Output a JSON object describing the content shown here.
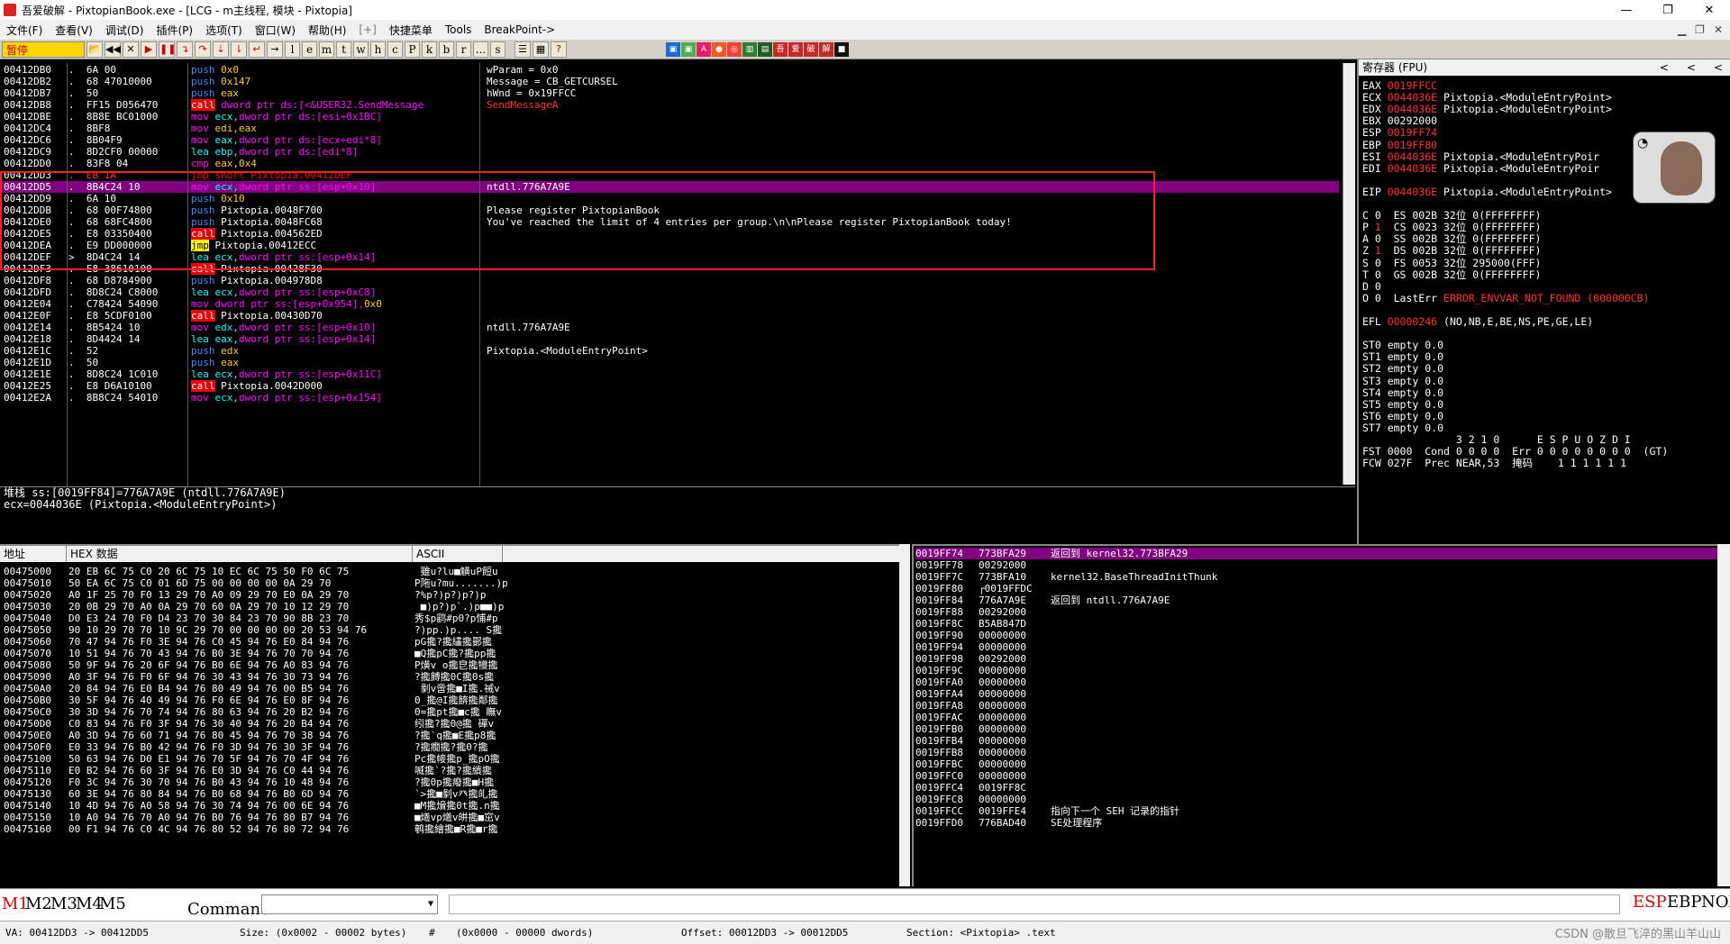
{
  "window": {
    "title": "吾爱破解 - PixtopianBook.exe - [LCG - m主线程, 模块 - Pixtopia]",
    "controls": [
      "—",
      "❐",
      "✕"
    ]
  },
  "menu": {
    "items": [
      "文件(F)",
      "查看(V)",
      "调试(D)",
      "插件(P)",
      "选项(T)",
      "窗口(W)",
      "帮助(H)",
      "[+]",
      "快捷菜单",
      "Tools",
      "BreakPoint->"
    ]
  },
  "toolbar": {
    "status": "暂停",
    "letters": [
      "l",
      "e",
      "m",
      "t",
      "w",
      "h",
      "c",
      "P",
      "k",
      "b",
      "r",
      "...",
      "s"
    ],
    "chinese": [
      "吾",
      "爱",
      "破",
      "解"
    ]
  },
  "cpu": {
    "rows": [
      {
        "addr": "00412DB0",
        "mark": ".",
        "hex": "6A 00",
        "asm": [
          [
            "push",
            "kw-push"
          ],
          [
            " 0x0",
            "num"
          ]
        ],
        "cmt": "wParam = 0x0"
      },
      {
        "addr": "00412DB2",
        "mark": ".",
        "hex": "68 47010000",
        "asm": [
          [
            "push",
            "kw-push"
          ],
          [
            " 0x147",
            "num"
          ]
        ],
        "cmt": "Message = CB_GETCURSEL"
      },
      {
        "addr": "00412DB7",
        "mark": ".",
        "hex": "50",
        "asm": [
          [
            "push",
            "kw-push"
          ],
          [
            " eax",
            "num"
          ]
        ],
        "cmt": "hWnd = 0x19FFCC"
      },
      {
        "addr": "00412DB8",
        "mark": ".",
        "hex": "FF15 D056470",
        "asm": [
          [
            "call",
            "kw-call"
          ],
          [
            " dword ptr ds:[<&USER32.SendMessage",
            "kw-mov"
          ]
        ],
        "cmt": "SendMessageA",
        "cmtClass": "red"
      },
      {
        "addr": "00412DBE",
        "mark": ".",
        "hex": "8B8E BC01000",
        "asm": [
          [
            "mov",
            "kw-mov"
          ],
          [
            " ecx,",
            "kw-lea"
          ],
          [
            "dword ptr ds:[esi+0x1BC]",
            "kw-mov"
          ]
        ],
        "cmt": ""
      },
      {
        "addr": "00412DC4",
        "mark": ".",
        "hex": "8BF8",
        "asm": [
          [
            "mov",
            "kw-mov"
          ],
          [
            " edi,eax",
            "num"
          ]
        ],
        "cmt": ""
      },
      {
        "addr": "00412DC6",
        "mark": ".",
        "hex": "8B04F9",
        "asm": [
          [
            "mov",
            "kw-mov"
          ],
          [
            " eax,",
            "kw-lea"
          ],
          [
            "dword ptr ds:[ecx+edi*8]",
            "kw-mov"
          ]
        ],
        "cmt": ""
      },
      {
        "addr": "00412DC9",
        "mark": ".",
        "hex": "8D2CF0 00000",
        "asm": [
          [
            "lea",
            "kw-lea"
          ],
          [
            " ebp,",
            "kw-lea"
          ],
          [
            "dword ptr ds:[edi*8]",
            "kw-mov"
          ]
        ],
        "cmt": ""
      },
      {
        "addr": "00412DD0",
        "mark": ".",
        "hex": "83F8 04",
        "asm": [
          [
            "cmp",
            "kw-cmp"
          ],
          [
            " eax,0x4",
            "num"
          ]
        ],
        "cmt": ""
      },
      {
        "addr": "00412DD3",
        "mark": ".",
        "hex": "EB 1A",
        "hexClass": "red",
        "asm": [
          [
            "jmp short Pixtopia.00412DEF",
            "kw-jmpr"
          ]
        ],
        "cmt": ""
      },
      {
        "addr": "00412DD5",
        "mark": ".",
        "hex": "8B4C24 10",
        "asm": [
          [
            "mov",
            "kw-mov"
          ],
          [
            " ecx,",
            "kw-lea"
          ],
          [
            "dword ptr ss:[esp+0x10]",
            "kw-mov"
          ]
        ],
        "cmt": "ntdll.776A7A9E",
        "sel": true
      },
      {
        "addr": "00412DD9",
        "mark": ".",
        "hex": "6A 10",
        "asm": [
          [
            "push",
            "kw-push"
          ],
          [
            " 0x10",
            "num"
          ]
        ],
        "cmt": ""
      },
      {
        "addr": "00412DDB",
        "mark": ".",
        "hex": "68 00F74800",
        "asm": [
          [
            "push",
            "kw-push"
          ],
          [
            " Pixtopia.0048F700",
            "ops"
          ]
        ],
        "cmt": "Please register PixtopianBook"
      },
      {
        "addr": "00412DE0",
        "mark": ".",
        "hex": "68 68FC4800",
        "asm": [
          [
            "push",
            "kw-push"
          ],
          [
            " Pixtopia.0048FC68",
            "ops"
          ]
        ],
        "cmt": "You've reached the limit of 4 entries per group.\\n\\nPlease register PixtopianBook today!"
      },
      {
        "addr": "00412DE5",
        "mark": ".",
        "hex": "E8 03350400",
        "asm": [
          [
            "call",
            "kw-call"
          ],
          [
            " Pixtopia.004562ED",
            "ops"
          ]
        ],
        "cmt": ""
      },
      {
        "addr": "00412DEA",
        "mark": ".",
        "hex": "E9 DD000000",
        "asm": [
          [
            "jmp",
            "kw-jmp"
          ],
          [
            " Pixtopia.00412ECC",
            "ops"
          ]
        ],
        "cmt": ""
      },
      {
        "addr": "00412DEF",
        "mark": ">",
        "hex": "8D4C24 14",
        "asm": [
          [
            "lea",
            "kw-lea"
          ],
          [
            " ecx,",
            "kw-lea"
          ],
          [
            "dword ptr ss:[esp+0x14]",
            "kw-mov"
          ]
        ],
        "cmt": ""
      },
      {
        "addr": "00412DF3",
        "mark": ".",
        "hex": "E8 38610100",
        "asm": [
          [
            "call",
            "kw-call"
          ],
          [
            " Pixtopia.00428F30",
            "ops"
          ]
        ],
        "cmt": ""
      },
      {
        "addr": "00412DF8",
        "mark": ".",
        "hex": "68 D8784900",
        "asm": [
          [
            "push",
            "kw-push"
          ],
          [
            " Pixtopia.004978D8",
            "ops"
          ]
        ],
        "cmt": ""
      },
      {
        "addr": "00412DFD",
        "mark": ".",
        "hex": "8D8C24 C8000",
        "asm": [
          [
            "lea",
            "kw-lea"
          ],
          [
            " ecx,",
            "kw-lea"
          ],
          [
            "dword ptr ss:[esp+0xC8]",
            "kw-mov"
          ]
        ],
        "cmt": ""
      },
      {
        "addr": "00412E04",
        "mark": ".",
        "hex": "C78424 54090",
        "asm": [
          [
            "mov",
            "kw-mov"
          ],
          [
            " dword ptr ss:[esp+0x954],",
            "kw-mov"
          ],
          [
            "0x0",
            "num"
          ]
        ],
        "cmt": ""
      },
      {
        "addr": "00412E0F",
        "mark": ".",
        "hex": "E8 5CDF0100",
        "asm": [
          [
            "call",
            "kw-call"
          ],
          [
            " Pixtopia.00430D70",
            "ops"
          ]
        ],
        "cmt": ""
      },
      {
        "addr": "00412E14",
        "mark": ".",
        "hex": "8B5424 10",
        "asm": [
          [
            "mov",
            "kw-mov"
          ],
          [
            " edx,",
            "kw-lea"
          ],
          [
            "dword ptr ss:[esp+0x10]",
            "kw-mov"
          ]
        ],
        "cmt": "ntdll.776A7A9E"
      },
      {
        "addr": "00412E18",
        "mark": ".",
        "hex": "8D4424 14",
        "asm": [
          [
            "lea",
            "kw-lea"
          ],
          [
            " eax,",
            "kw-lea"
          ],
          [
            "dword ptr ss:[esp+0x14]",
            "kw-mov"
          ]
        ],
        "cmt": ""
      },
      {
        "addr": "00412E1C",
        "mark": ".",
        "hex": "52",
        "asm": [
          [
            "push",
            "kw-push"
          ],
          [
            " edx",
            "num"
          ]
        ],
        "cmt": "Pixtopia.<ModuleEntryPoint>"
      },
      {
        "addr": "00412E1D",
        "mark": ".",
        "hex": "50",
        "asm": [
          [
            "push",
            "kw-push"
          ],
          [
            " eax",
            "num"
          ]
        ],
        "cmt": ""
      },
      {
        "addr": "00412E1E",
        "mark": ".",
        "hex": "8D8C24 1C010",
        "asm": [
          [
            "lea",
            "kw-lea"
          ],
          [
            " ecx,",
            "kw-lea"
          ],
          [
            "dword ptr ss:[esp+0x11C]",
            "kw-mov"
          ]
        ],
        "cmt": ""
      },
      {
        "addr": "00412E25",
        "mark": ".",
        "hex": "E8 D6A10100",
        "asm": [
          [
            "call",
            "kw-call"
          ],
          [
            " Pixtopia.0042D000",
            "ops"
          ]
        ],
        "cmt": ""
      },
      {
        "addr": "00412E2A",
        "mark": ".",
        "hex": "8B8C24 54010",
        "asm": [
          [
            "mov",
            "kw-mov"
          ],
          [
            " ecx,",
            "kw-lea"
          ],
          [
            "dword ptr ss:[esp+0x154]",
            "kw-mov"
          ]
        ],
        "cmt": ""
      }
    ]
  },
  "info": {
    "line1": "堆栈 ss:[0019FF84]=776A7A9E (ntdll.776A7A9E)",
    "line2": "ecx=0044036E (Pixtopia.<ModuleEntryPoint>)"
  },
  "registers": {
    "header": "寄存器 (FPU)",
    "lines": [
      [
        [
          "EAX ",
          "w"
        ],
        [
          "0019FFCC",
          "r"
        ]
      ],
      [
        [
          "ECX ",
          "w"
        ],
        [
          "0044036E",
          "r"
        ],
        [
          " Pixtopia.<ModuleEntryPoint>",
          "w"
        ]
      ],
      [
        [
          "EDX ",
          "w"
        ],
        [
          "0044036E",
          "r"
        ],
        [
          " Pixtopia.<ModuleEntryPoint>",
          "w"
        ]
      ],
      [
        [
          "EBX 00292000",
          "w"
        ]
      ],
      [
        [
          "ESP ",
          "w"
        ],
        [
          "0019FF74",
          "r"
        ]
      ],
      [
        [
          "EBP ",
          "w"
        ],
        [
          "0019FF80",
          "r"
        ]
      ],
      [
        [
          "ESI ",
          "w"
        ],
        [
          "0044036E",
          "r"
        ],
        [
          " Pixtopia.<ModuleEntryPoir",
          "w"
        ]
      ],
      [
        [
          "EDI ",
          "w"
        ],
        [
          "0044036E",
          "r"
        ],
        [
          " Pixtopia.<ModuleEntryPoir",
          "w"
        ]
      ],
      [
        [
          "",
          ""
        ]
      ],
      [
        [
          "EIP ",
          "w"
        ],
        [
          "0044036E",
          "r"
        ],
        [
          " Pixtopia.<ModuleEntryPoint>",
          "w"
        ]
      ],
      [
        [
          "",
          ""
        ]
      ],
      [
        [
          "C 0  ES 002B 32位 0(FFFFFFFF)",
          "w"
        ]
      ],
      [
        [
          "P ",
          "w"
        ],
        [
          "1",
          "r"
        ],
        [
          "  CS 0023 32位 0(FFFFFFFF)",
          "w"
        ]
      ],
      [
        [
          "A 0  SS 002B 32位 0(FFFFFFFF)",
          "w"
        ]
      ],
      [
        [
          "Z ",
          "w"
        ],
        [
          "1",
          "r"
        ],
        [
          "  DS 002B 32位 0(FFFFFFFF)",
          "w"
        ]
      ],
      [
        [
          "S 0  FS 0053 32位 295000(FFF)",
          "w"
        ]
      ],
      [
        [
          "T 0  GS 002B 32位 0(FFFFFFFF)",
          "w"
        ]
      ],
      [
        [
          "D 0",
          "w"
        ]
      ],
      [
        [
          "O 0  LastErr ",
          "w"
        ],
        [
          "ERROR_ENVVAR_NOT_FOUND (000000CB)",
          "r"
        ]
      ],
      [
        [
          "",
          ""
        ]
      ],
      [
        [
          "EFL ",
          "w"
        ],
        [
          "00000246",
          "r"
        ],
        [
          " (NO,NB,E,BE,NS,PE,GE,LE)",
          "w"
        ]
      ],
      [
        [
          "",
          ""
        ]
      ],
      [
        [
          "ST0 empty 0.0",
          "w"
        ]
      ],
      [
        [
          "ST1 empty 0.0",
          "w"
        ]
      ],
      [
        [
          "ST2 empty 0.0",
          "w"
        ]
      ],
      [
        [
          "ST3 empty 0.0",
          "w"
        ]
      ],
      [
        [
          "ST4 empty 0.0",
          "w"
        ]
      ],
      [
        [
          "ST5 empty 0.0",
          "w"
        ]
      ],
      [
        [
          "ST6 empty 0.0",
          "w"
        ]
      ],
      [
        [
          "ST7 empty 0.0",
          "w"
        ]
      ],
      [
        [
          "               3 2 1 0      E S P U O Z D I",
          "w"
        ]
      ],
      [
        [
          "FST 0000  Cond 0 0 0 0  Err 0 0 0 0 0 0 0 0  (GT)",
          "w"
        ]
      ],
      [
        [
          "FCW 027F  Prec NEAR,53  掩码    1 1 1 1 1 1",
          "w"
        ]
      ]
    ]
  },
  "dump": {
    "headers": [
      "地址",
      "HEX 数据",
      "ASCII"
    ],
    "rows": [
      [
        "00475000",
        "20 EB 6C 75 C0 20 6C 75 10 EC 6C 75 50 F0 6C 75",
        " 雖u?lu■觵uP餖u"
      ],
      [
        "00475010",
        "50 EA 6C 75 C0 01 6D 75 00 00 00 00 0A 29 70",
        "P陁u?mu.......)p"
      ],
      [
        "00475020",
        "A0 1F 25 70 F0 13 29 70 A0 09 29 70 E0 0A 29 70",
        "?%p?)p?)p?)p"
      ],
      [
        "00475030",
        "20 0B 29 70 A0 0A 29 70 60 0A 29 70 10 12 29 70",
        " ■)p?)p`.)p■■)p"
      ],
      [
        "00475040",
        "D0 E3 24 70 F0 D4 23 70 30 84 23 70 90 8B 23 70",
        "秀$p鹞#p0?p悑#p"
      ],
      [
        "00475050",
        "90 10 29 70 70 10 9C 29 70 00 00 00 00 20 53 94 76",
        "?)pp.)p.... S攙"
      ],
      [
        "00475060",
        "70 47 94 76 F0 3E 94 76 C0 45 94 76 E0 84 94 76",
        "pG攙?攙繣攙鄤攙"
      ],
      [
        "00475070",
        "10 51 94 76 70 43 94 76 B0 3E 94 76 70 70 94 76",
        "■Q攙pC攙?攙pp攙"
      ],
      [
        "00475080",
        "50 9F 94 76 20 6F 94 76 B0 6E 94 76 A0 83 94 76",
        "P熿v o攙皀攙犪攙"
      ],
      [
        "00475090",
        "A0 3F 94 76 F0 6F 94 76 30 43 94 76 30 73 94 76",
        "?攙餺攙0C攙0s攙"
      ],
      [
        "004750A0",
        "20 84 94 76 E0 B4 94 76 80 49 94 76 00 B5 94 76",
        " 剶v啻攙■I攙.祴v"
      ],
      [
        "004750B0",
        "30 5F 94 76 40 49 94 76 F0 6E 94 76 E0 8F 94 76",
        "0_攙@I攙餴攙鄰攙"
      ],
      [
        "004750C0",
        "30 3D 94 76 70 74 94 76 80 63 94 76 20 B2 94 76",
        "0=攙pt攙■c攙 瞴v"
      ],
      [
        "004750D0",
        "C0 83 94 76 F0 3F 94 76 30 40 94 76 20 B4 94 76",
        "纼攙?攙0@攙 磾v"
      ],
      [
        "004750E0",
        "A0 3D 94 76 60 71 94 76 80 45 94 76 70 38 94 76",
        "?攙`q攙■E攙p8攙"
      ],
      [
        "004750F0",
        "E0 33 94 76 B0 42 94 76 F0 3D 94 76 30 3F 94 76",
        "?攙癇攙?攙0?攙"
      ],
      [
        "00475100",
        "50 63 94 76 D0 E1 94 76 70 5F 94 76 70 4F 94 76",
        "Pc攙帹攙p_攙pO攙"
      ],
      [
        "00475110",
        "E0 B2 94 76 60 3F 94 76 E0 3D 94 76 C0 44 94 76",
        "喴攙`?攙?攙繢攙"
      ],
      [
        "00475120",
        "F0 3C 94 76 30 70 94 76 B0 43 94 76 10 48 94 76",
        "?攙0p攙癈攙■H攙"
      ],
      [
        "00475130",
        "60 3E 94 76 80 84 94 76 B0 68 94 76 B0 6D 94 76",
        "`>攙■剶v癶攙癿攙"
      ],
      [
        "00475140",
        "10 4D 94 76 A0 58 94 76 30 74 94 76 00 6E 94 76",
        "■M攙燲攙0t攙.n攙"
      ],
      [
        "00475150",
        "10 A0 94 76 70 A0 94 76 B0 76 94 76 80 B7 94 76",
        "■爔vp爔v皏攙■窋v"
      ],
      [
        "00475160",
        "00 F1 94 76 C0 4C 94 76 80 52 94 76 80 72 94 76",
        "鹌攙繪攙■R攙■r攙"
      ]
    ]
  },
  "stack": {
    "rows": [
      {
        "addr": "0019FF74",
        "val": "773BFA29",
        "cmt": "返回到 kernel32.773BFA29",
        "sel": true
      },
      {
        "addr": "0019FF78",
        "val": "00292000",
        "cmt": ""
      },
      {
        "addr": "0019FF7C",
        "val": "773BFA10",
        "cmt": "kernel32.BaseThreadInitThunk"
      },
      {
        "addr": "0019FF80",
        "val": "┌0019FFDC",
        "cmt": ""
      },
      {
        "addr": "0019FF84",
        "val": "776A7A9E",
        "cmt": "返回到 ntdll.776A7A9E"
      },
      {
        "addr": "0019FF88",
        "val": "00292000",
        "cmt": ""
      },
      {
        "addr": "0019FF8C",
        "val": "B5AB847D",
        "cmt": ""
      },
      {
        "addr": "0019FF90",
        "val": "00000000",
        "cmt": ""
      },
      {
        "addr": "0019FF94",
        "val": "00000000",
        "cmt": ""
      },
      {
        "addr": "0019FF98",
        "val": "00292000",
        "cmt": ""
      },
      {
        "addr": "0019FF9C",
        "val": "00000000",
        "cmt": ""
      },
      {
        "addr": "0019FFA0",
        "val": "00000000",
        "cmt": ""
      },
      {
        "addr": "0019FFA4",
        "val": "00000000",
        "cmt": ""
      },
      {
        "addr": "0019FFA8",
        "val": "00000000",
        "cmt": ""
      },
      {
        "addr": "0019FFAC",
        "val": "00000000",
        "cmt": ""
      },
      {
        "addr": "0019FFB0",
        "val": "00000000",
        "cmt": ""
      },
      {
        "addr": "0019FFB4",
        "val": "00000000",
        "cmt": ""
      },
      {
        "addr": "0019FFB8",
        "val": "00000000",
        "cmt": ""
      },
      {
        "addr": "0019FFBC",
        "val": "00000000",
        "cmt": ""
      },
      {
        "addr": "0019FFC0",
        "val": "00000000",
        "cmt": ""
      },
      {
        "addr": "0019FFC4",
        "val": "0019FF8C",
        "cmt": ""
      },
      {
        "addr": "0019FFC8",
        "val": "00000000",
        "cmt": ""
      },
      {
        "addr": "0019FFCC",
        "val": "0019FFE4",
        "cmt": "指向下一个 SEH 记录的指针"
      },
      {
        "addr": "0019FFD0",
        "val": "776BAD40",
        "cmt": "SE处理程序"
      }
    ]
  },
  "command": {
    "mbuttons": [
      "M1",
      "M2",
      "M3",
      "M4",
      "M5"
    ],
    "label": "Command",
    "right": [
      "ESP",
      "EBP",
      "NONE"
    ]
  },
  "statusbar": {
    "va": "VA: 00412DD3 -> 00412DD5",
    "size": "Size: (0x0002 - 00002 bytes)",
    "hash": "#",
    "dwords": "(0x0000 - 00000 dwords)",
    "offset": "Offset: 00012DD3 -> 00012DD5",
    "section": "Section: <Pixtopia> .text",
    "watermark": "CSDN @散旦飞淬的黑山羊山山"
  },
  "colors": {
    "accent_red": "#ff2020",
    "selection": "#800080"
  }
}
